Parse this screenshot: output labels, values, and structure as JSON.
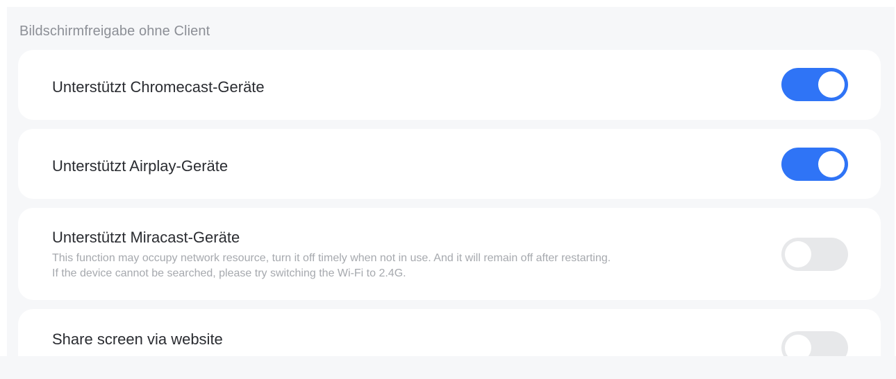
{
  "section": {
    "title": "Bildschirmfreigabe ohne Client"
  },
  "settings": [
    {
      "label": "Unterstützt Chromecast-Geräte",
      "enabled": true
    },
    {
      "label": "Unterstützt Airplay-Geräte",
      "enabled": true
    },
    {
      "label": "Unterstützt Miracast-Geräte",
      "description_line1": "This function may occupy network resource, turn it off timely when not in use. And it will remain off after restarting.",
      "description_line2": "If the device cannot be searched, please try switching the Wi-Fi to 2.4G.",
      "enabled": false
    },
    {
      "label": "Share screen via website",
      "enabled": false
    }
  ],
  "colors": {
    "toggle_on": "#2f74f6",
    "toggle_off": "#e7e8ea",
    "background": "#f6f7f9",
    "card": "#ffffff"
  }
}
